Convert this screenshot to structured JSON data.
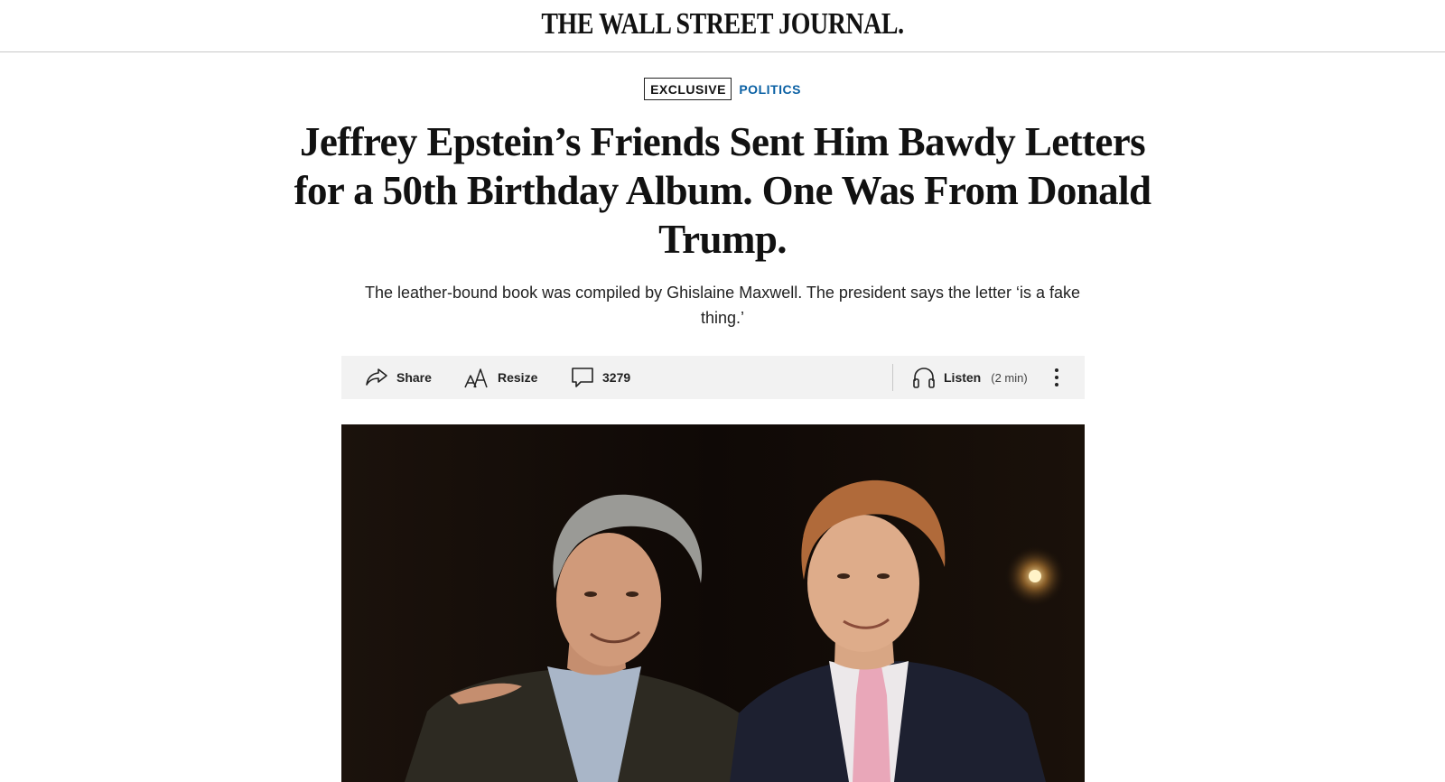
{
  "masthead": {
    "logo": "THE WALL STREET JOURNAL."
  },
  "article": {
    "flag": "EXCLUSIVE",
    "section": "POLITICS",
    "headline": "Jeffrey Epstein’s Friends Sent Him Bawdy Letters for a 50th Birthday Album. One Was From Donald Trump.",
    "dek": "The leather-bound book was compiled by Ghislaine Maxwell. The president says the letter ‘is a fake thing.’"
  },
  "toolbar": {
    "share_label": "Share",
    "resize_label": "Resize",
    "comment_count": "3279",
    "listen_label": "Listen",
    "listen_duration": "(2 min)",
    "icons": [
      "share-icon",
      "resize-icon",
      "comment-icon",
      "headphones-icon",
      "more-icon"
    ]
  },
  "colors": {
    "section_link": "#0b61a4",
    "toolbar_background": "#f2f2f2",
    "photo_background": "#140c08"
  }
}
